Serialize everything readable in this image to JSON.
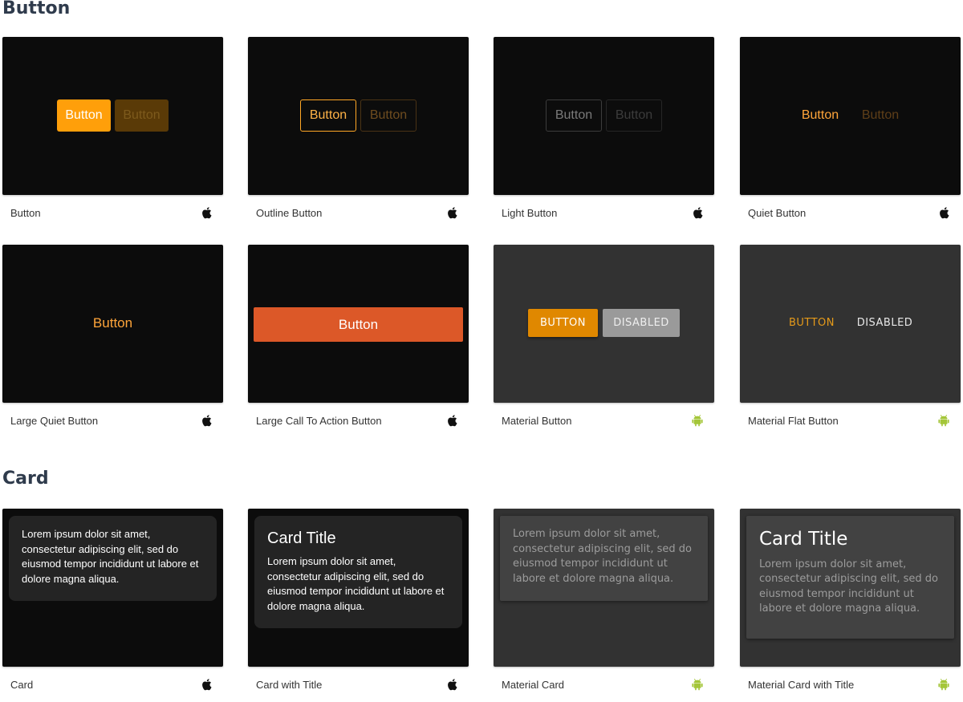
{
  "sections": {
    "button": {
      "title": "Button"
    },
    "card": {
      "title": "Card"
    }
  },
  "colors": {
    "ios_accent": "#ff9f0a",
    "cta": "#dc5828",
    "material_accent": "#e08800",
    "android_green": "#a4c639"
  },
  "button_tiles": [
    {
      "caption": "Button",
      "platform": "apple-icon",
      "primary": "Button",
      "secondary": "Button"
    },
    {
      "caption": "Outline Button",
      "platform": "apple-icon",
      "primary": "Button",
      "secondary": "Button"
    },
    {
      "caption": "Light Button",
      "platform": "apple-icon",
      "primary": "Button",
      "secondary": "Button"
    },
    {
      "caption": "Quiet Button",
      "platform": "apple-icon",
      "primary": "Button",
      "secondary": "Button"
    },
    {
      "caption": "Large Quiet Button",
      "platform": "apple-icon",
      "primary": "Button"
    },
    {
      "caption": "Large Call To Action Button",
      "platform": "apple-icon",
      "primary": "Button"
    },
    {
      "caption": "Material Button",
      "platform": "android-icon",
      "primary": "BUTTON",
      "secondary": "DISABLED"
    },
    {
      "caption": "Material Flat Button",
      "platform": "android-icon",
      "primary": "BUTTON",
      "secondary": "DISABLED"
    }
  ],
  "card_tiles": [
    {
      "caption": "Card",
      "platform": "apple-icon",
      "body": "Lorem ipsum dolor sit amet, consectetur adipiscing elit, sed do eiusmod tempor incididunt ut labore et dolore magna aliqua."
    },
    {
      "caption": "Card with Title",
      "platform": "apple-icon",
      "title": "Card Title",
      "body": "Lorem ipsum dolor sit amet, consectetur adipiscing elit, sed do eiusmod tempor incididunt ut labore et dolore magna aliqua."
    },
    {
      "caption": "Material Card",
      "platform": "android-icon",
      "body": "Lorem ipsum dolor sit amet, consectetur adipiscing elit, sed do eiusmod tempor incididunt ut labore et dolore magna aliqua."
    },
    {
      "caption": "Material Card with Title",
      "platform": "android-icon",
      "title": "Card Title",
      "body": "Lorem ipsum dolor sit amet, consectetur adipiscing elit, sed do eiusmod tempor incididunt ut labore et dolore magna aliqua."
    }
  ]
}
